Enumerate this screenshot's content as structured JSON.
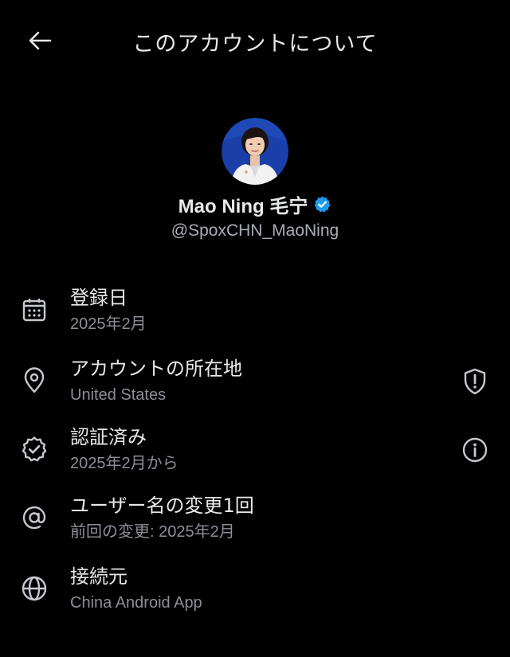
{
  "header": {
    "title": "このアカウントについて",
    "back_icon": "arrow-left-icon"
  },
  "profile": {
    "display_name": "Mao Ning 毛宁",
    "handle": "@SpoxCHN_MaoNing",
    "verified_icon": "verified-badge-icon",
    "verified_color": "#1d9bf0"
  },
  "info": {
    "joined": {
      "title": "登録日",
      "value": "2025年2月",
      "icon": "calendar-icon"
    },
    "location": {
      "title": "アカウントの所在地",
      "value": "United States",
      "icon": "location-pin-icon",
      "action_icon": "shield-alert-icon"
    },
    "verified": {
      "title": "認証済み",
      "value": "2025年2月から",
      "icon": "verified-check-icon",
      "action_icon": "info-icon"
    },
    "username_changes": {
      "title": "ユーザー名の変更1回",
      "value": "前回の変更: 2025年2月",
      "icon": "at-sign-icon"
    },
    "connected_via": {
      "title": "接続元",
      "value": "China Android App",
      "icon": "globe-icon"
    }
  },
  "colors": {
    "background": "#000000",
    "primary_text": "#e7e9ea",
    "secondary_text": "#8a9096",
    "icon": "#c4c9cd"
  }
}
